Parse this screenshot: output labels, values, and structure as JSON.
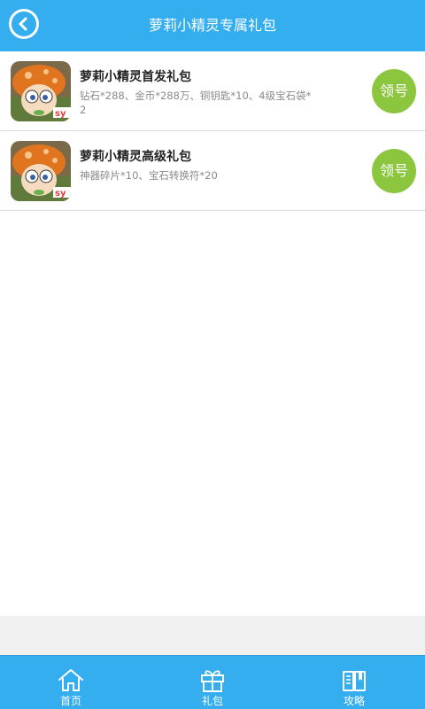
{
  "header": {
    "title": "萝莉小精灵专属礼包",
    "back_icon": "chevron-left-icon"
  },
  "gifts": [
    {
      "title": "萝莉小精灵首发礼包",
      "desc": "钻石*288、金币*288万、铜钥匙*10、4级宝石袋*2",
      "button_label": "领号",
      "icon": "mushroom-character-icon"
    },
    {
      "title": "萝莉小精灵高级礼包",
      "desc": "神器碎片*10、宝石转换符*20",
      "button_label": "领号",
      "icon": "mushroom-character-icon"
    }
  ],
  "tabbar": {
    "tabs": [
      {
        "label": "首页",
        "icon": "home-icon"
      },
      {
        "label": "礼包",
        "icon": "gift-icon"
      },
      {
        "label": "攻略",
        "icon": "book-icon"
      }
    ]
  },
  "colors": {
    "accent": "#35aef0",
    "button": "#8cc63f"
  }
}
